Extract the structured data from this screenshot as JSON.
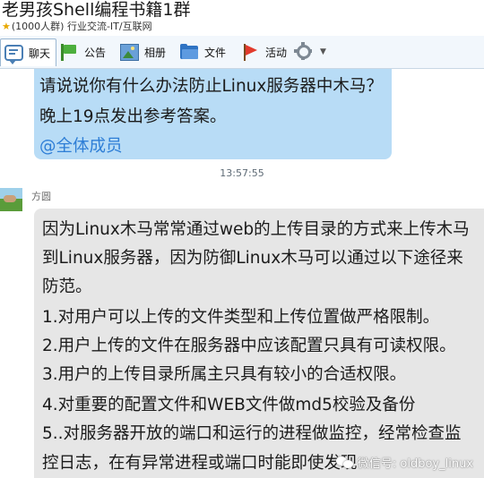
{
  "window": {
    "title": "老男孩Shell编程书籍1群",
    "subtitle": "(1000人群) 行业交流-IT/互联网"
  },
  "toolbar": {
    "items": [
      {
        "label": "聊天",
        "icon": "chat-icon"
      },
      {
        "label": "公告",
        "icon": "flag-icon"
      },
      {
        "label": "相册",
        "icon": "photo-icon"
      },
      {
        "label": "文件",
        "icon": "folder-icon"
      },
      {
        "label": "活动",
        "icon": "red-flag-icon"
      }
    ],
    "more_icon": "gear-icon"
  },
  "messages": {
    "first": {
      "lines": [
        "请说说你有什么办法防止Linux服务器中木马？",
        "晚上19点发出参考答案。"
      ],
      "mention": "@全体成员"
    },
    "timestamp": "13:57:55",
    "second": {
      "sender": "方圆",
      "lines": [
        "因为Linux木马常常通过web的上传目录的方式来上传木马",
        "到Linux服务器，因为防御Linux木马可以通过以下途径来",
        "防范。",
        "1.对用户可以上传的文件类型和上传位置做严格限制。",
        "2.用户上传的文件在服务器中应该配置只具有可读权限。",
        "3.用户的上传目录所属主只具有较小的合适权限。",
        "4.对重要的配置文件和WEB文件做md5校验及备份",
        "5..对服务器开放的端口和运行的进程做监控，经常检查监",
        "控日志，在有异常进程或端口时能即使发现"
      ]
    }
  },
  "watermark": {
    "text": "微信号: oldboy_linux"
  },
  "colors": {
    "bubble_self": "#b8dcf6",
    "bubble_other": "#e6e6e6",
    "mention": "#2e7ed6"
  }
}
